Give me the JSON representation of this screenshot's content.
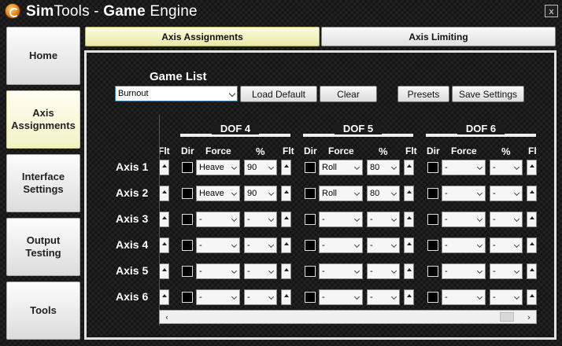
{
  "app": {
    "title_bold": "Sim",
    "title_light": "Tools - ",
    "title_bold2": "Game",
    "title_end": " Engine",
    "close_label": "x"
  },
  "sidebar": {
    "items": [
      {
        "label": "Home"
      },
      {
        "label": "Axis Assignments",
        "active": true
      },
      {
        "label": "Interface Settings"
      },
      {
        "label": "Output Testing"
      },
      {
        "label": "Tools"
      }
    ]
  },
  "tabs": [
    {
      "label": "Axis Assignments",
      "active": true
    },
    {
      "label": "Axis Limiting"
    }
  ],
  "toolbar": {
    "game_list_label": "Game List",
    "game_selected": "Burnout",
    "load_default": "Load Default",
    "clear": "Clear",
    "presets": "Presets",
    "save_settings": "Save Settings"
  },
  "grid": {
    "dof_headers": [
      "DOF 4",
      "DOF 5",
      "DOF 6"
    ],
    "col_headers": {
      "flt": "Flt",
      "dir": "Dir",
      "force": "Force",
      "percent": "%"
    },
    "axes": [
      {
        "label": "Axis 1",
        "dof": [
          {
            "force": "Heave",
            "pct": "90"
          },
          {
            "force": "Roll",
            "pct": "80"
          },
          {
            "force": "-",
            "pct": "-"
          }
        ]
      },
      {
        "label": "Axis 2",
        "dof": [
          {
            "force": "Heave",
            "pct": "90"
          },
          {
            "force": "Roll",
            "pct": "80"
          },
          {
            "force": "-",
            "pct": "-"
          }
        ]
      },
      {
        "label": "Axis 3",
        "dof": [
          {
            "force": "-",
            "pct": "-"
          },
          {
            "force": "-",
            "pct": "-"
          },
          {
            "force": "-",
            "pct": "-"
          }
        ]
      },
      {
        "label": "Axis 4",
        "dof": [
          {
            "force": "-",
            "pct": "-"
          },
          {
            "force": "-",
            "pct": "-"
          },
          {
            "force": "-",
            "pct": "-"
          }
        ]
      },
      {
        "label": "Axis 5",
        "dof": [
          {
            "force": "-",
            "pct": "-"
          },
          {
            "force": "-",
            "pct": "-"
          },
          {
            "force": "-",
            "pct": "-"
          }
        ]
      },
      {
        "label": "Axis 6",
        "dof": [
          {
            "force": "-",
            "pct": "-"
          },
          {
            "force": "-",
            "pct": "-"
          },
          {
            "force": "-",
            "pct": "-"
          }
        ]
      }
    ]
  }
}
